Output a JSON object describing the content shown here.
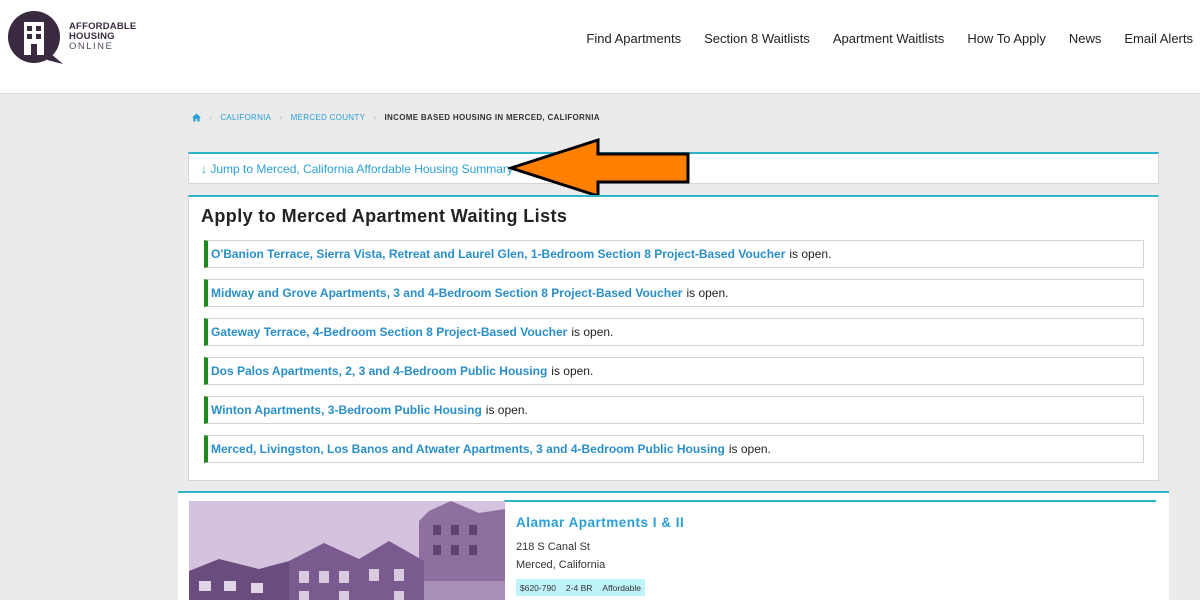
{
  "header": {
    "logo": {
      "line1": "AFFORDABLE",
      "line2": "HOUSING",
      "line3": "ONLINE"
    },
    "nav": [
      "Find Apartments",
      "Section 8 Waitlists",
      "Apartment Waitlists",
      "How To Apply",
      "News",
      "Email Alerts"
    ]
  },
  "breadcrumb": {
    "home_icon": "home-icon",
    "items": [
      "California",
      "Merced County"
    ],
    "current": "Income Based Housing in Merced, California"
  },
  "jump": {
    "label": "↓ Jump to Merced, California Affordable Housing Summary"
  },
  "annotation": {
    "arrow_color": "#ff8000",
    "arrow_icon": "arrow-left-icon"
  },
  "waitlists": {
    "title": "Apply to Merced Apartment Waiting Lists",
    "items": [
      {
        "link": "O'Banion Terrace, Sierra Vista, Retreat and Laurel Glen, 1-Bedroom Section 8 Project-Based Voucher",
        "status": "is open."
      },
      {
        "link": "Midway and Grove Apartments, 3 and 4-Bedroom Section 8 Project-Based Voucher",
        "status": "is open."
      },
      {
        "link": "Gateway Terrace, 4-Bedroom Section 8 Project-Based Voucher",
        "status": "is open."
      },
      {
        "link": "Dos Palos Apartments, 2, 3 and 4-Bedroom Public Housing",
        "status": "is open."
      },
      {
        "link": "Winton Apartments, 3-Bedroom Public Housing",
        "status": "is open."
      },
      {
        "link": "Merced, Livingston, Los Banos and Atwater Apartments, 3 and 4-Bedroom Public Housing",
        "status": "is open."
      }
    ]
  },
  "property": {
    "name": "Alamar Apartments I & II",
    "address1": "218 S Canal St",
    "address2": "Merced, California",
    "tags": [
      "$620-790",
      "2-4 BR",
      "Affordable"
    ]
  },
  "colors": {
    "accent": "#2ab5c8",
    "link": "#2a9fd6",
    "open_bar": "#1d8a1d",
    "logo": "#3a2a40",
    "tag_bg": "#bff3fa"
  }
}
